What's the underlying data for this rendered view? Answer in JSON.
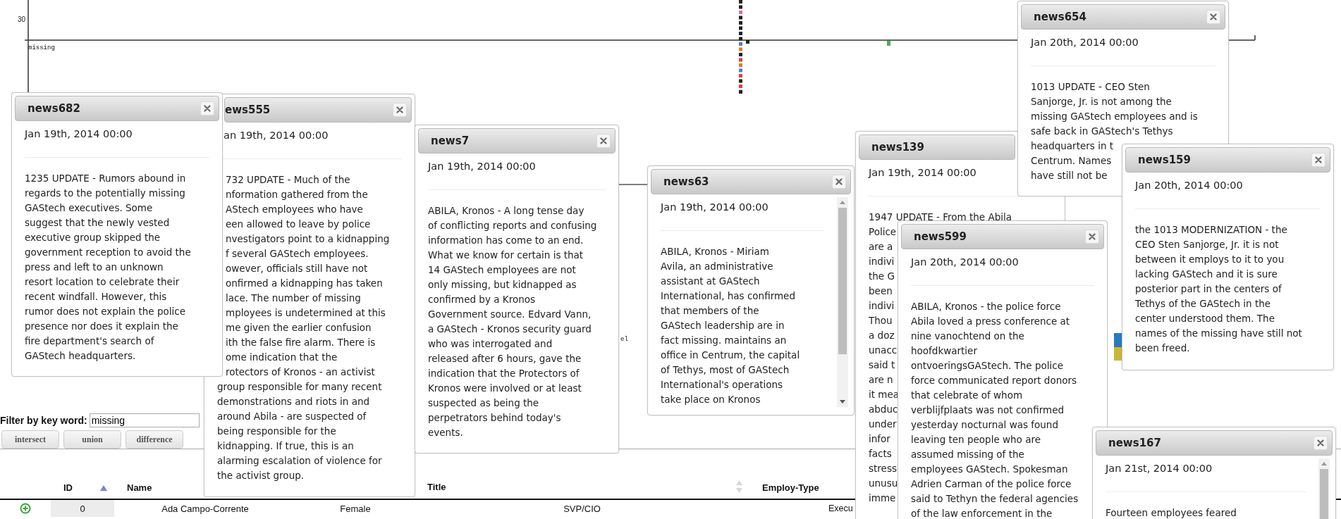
{
  "chart": {
    "tick": "30",
    "labels": [
      "missing",
      "el"
    ]
  },
  "filter": {
    "label": "Filter by key word:",
    "value": "missing"
  },
  "set_buttons": [
    "intersect",
    "union",
    "difference"
  ],
  "table": {
    "columns": [
      {
        "label": "ID",
        "sorted": true
      },
      {
        "label": "Name"
      },
      {
        "label": "Title",
        "sorted": false
      },
      {
        "label": "Employ-Type"
      }
    ],
    "rows": [
      {
        "expanded": false,
        "cells": [
          "0",
          "Ada Campo-Corrente",
          "Female",
          "SVP/CIO",
          "Execu"
        ]
      }
    ]
  },
  "windows": [
    {
      "title": "news682",
      "date": "Jan 19th, 2014 00:00",
      "kind": "plain",
      "lines": [
        "1235 UPDATE - Rumors abound in",
        "regards to the potentially missing",
        "GAStech executives. Some",
        "suggest that the newly vested",
        "executive group skipped the",
        "government reception to avoid the",
        "press and left to an unknown",
        "resort location to celebrate their",
        "recent windfall. However, this",
        "rumor does not explain the police",
        "presence nor does it explain the",
        "fire department's search of",
        "GAStech headquarters."
      ]
    },
    {
      "title": "ews555",
      "date": "an 19th, 2014 00:00",
      "kind": "covered-left",
      "covered_lines": [
        "732 UPDATE - Much of the",
        "nformation gathered from the",
        "AStech employees who have",
        "een allowed to leave by police",
        "nvestigators point to a kidnapping",
        "f several GAStech employees.",
        "owever, officials still have not",
        "onfirmed a kidnapping has taken",
        "lace. The number of missing",
        "mployees is undetermined at this",
        "me given the earlier confusion",
        "ith the false fire alarm. There is",
        "ome indication that the",
        "rotectors of Kronos - an activist"
      ],
      "lines": [
        "group responsible for many recent",
        "demonstrations and riots in and",
        "around Abila - are suspected of",
        "being responsible for the",
        "kidnapping. If true, this is an",
        "alarming escalation of violence for",
        "the activist group."
      ]
    },
    {
      "title": "news7",
      "date": "Jan 19th, 2014 00:00",
      "kind": "plain",
      "lines": [
        "ABILA, Kronos - A long tense day",
        "of conflicting reports and confusing",
        "information has come to an end.",
        "What we know for certain is that",
        "14 GAStech employees are not",
        "only missing, but kidnapped as",
        "confirmed by a Kronos",
        "Government source. Edvard Vann,",
        "a GAStech - Kronos security guard",
        "who was interrogated and",
        "released after 6 hours, gave the",
        "indication that the Protectors of",
        "Kronos were involved or at least",
        "suspected as being the",
        "perpetrators behind today's",
        "events."
      ]
    },
    {
      "title": "news63",
      "date": "Jan 19th, 2014 00:00",
      "kind": "scroll",
      "lines": [
        "ABILA, Kronos - Miriam",
        "Avila, an administrative",
        "assistant at GAStech",
        "International, has confirmed",
        "that members of the",
        "GAStech leadership are in",
        "fact missing. maintains an",
        "office in Centrum, the capital",
        "of Tethys, most of GAStech",
        "International's operations",
        "take place on Kronos"
      ]
    },
    {
      "title": "news139",
      "date": "Jan 19th, 2014 00:00",
      "kind": "covered-right",
      "lines": [
        "1947 UPDATE - From the Abila",
        "Police",
        "are a",
        "indivi",
        "the G",
        "been",
        "indivi",
        "Thou",
        "a doz",
        "unacc",
        "said t",
        "are n",
        "it mea",
        "abduc",
        "under",
        "infor",
        "facts",
        "stress",
        "unusu",
        "imme"
      ]
    },
    {
      "title": "news654",
      "date": "Jan 20th, 2014 00:00",
      "kind": "plain",
      "lines": [
        "1013 UPDATE - CEO Sten",
        "Sanjorge, Jr. is not among the",
        "missing GAStech employees and is",
        "safe back in GAStech's Tethys",
        "headquarters in t",
        "Centrum. Names",
        "have still not be"
      ]
    },
    {
      "title": "news159",
      "date": "Jan 20th, 2014 00:00",
      "kind": "plain",
      "lines": [
        "the 1013 MODERNIZATION - the",
        "CEO Sten Sanjorge, Jr. it is not",
        "between it employs to it to you",
        "lacking GAStech and it is sure",
        "posterior part in the centers of",
        "Tethys of the GAStech in the",
        "center understood them. The",
        "names of the missing have still not",
        "been freed."
      ]
    },
    {
      "title": "news599",
      "date": "Jan 20th, 2014 00:00",
      "kind": "plain",
      "lines": [
        "ABILA, Kronos - the police force",
        "Abila loved a press conference at",
        "nine vanochtend on the",
        "hoofdkwartier",
        "ontvoeringsGAStech. The police",
        "force communicated report donors",
        "that celebrate of whom",
        "verblijfplaats was not confirmed",
        "yesterday nocturnal was found",
        "leaving ten people who are",
        "assumed missing of the",
        "employees GAStech. Spokesman",
        "Adrien Carman of the police force",
        "said to Tethyn the federal agencies",
        "of the law enforcement in the"
      ]
    },
    {
      "title": "news167",
      "date": "Jan 21st, 2014 00:00",
      "kind": "scroll",
      "lines": [
        "Fourteen employees feared"
      ]
    }
  ]
}
